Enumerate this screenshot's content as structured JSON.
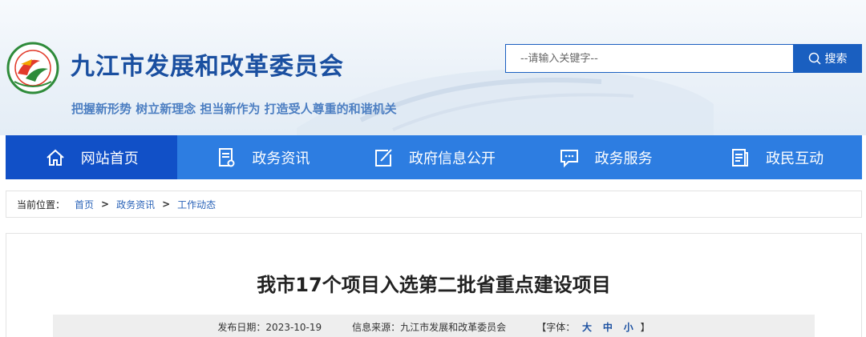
{
  "header": {
    "site_title": "九江市发展和改革委员会",
    "slogan": "把握新形势 树立新理念 担当新作为 打造受人尊重的和谐机关",
    "logo_icon": "jiujiang-drc-logo-icon"
  },
  "search": {
    "placeholder": "--请输入关键字--",
    "button_label": "搜索",
    "icon": "search-icon"
  },
  "nav": {
    "items": [
      {
        "label": "网站首页",
        "icon": "home-icon",
        "active": true
      },
      {
        "label": "政务资讯",
        "icon": "document-icon",
        "active": false
      },
      {
        "label": "政府信息公开",
        "icon": "edit-icon",
        "active": false
      },
      {
        "label": "政务服务",
        "icon": "chat-icon",
        "active": false
      },
      {
        "label": "政民互动",
        "icon": "clipboard-icon",
        "active": false
      }
    ]
  },
  "breadcrumb": {
    "label": "当前位置：",
    "items": [
      "首页",
      "政务资讯",
      "工作动态"
    ],
    "separator": ">"
  },
  "article": {
    "title": "我市17个项目入选第二批省重点建设项目",
    "publish_date": "发布日期：2023-10-19",
    "source": "信息来源：九江市发展和改革委员会",
    "font_label": "【字体：",
    "font_large": "大",
    "font_medium": "中",
    "font_small": "小",
    "font_close": "】"
  },
  "colors": {
    "brand_blue": "#1a4fa0",
    "nav_blue": "#2d7de1",
    "nav_active": "#1150c7",
    "search_blue": "#1a5fc0"
  }
}
